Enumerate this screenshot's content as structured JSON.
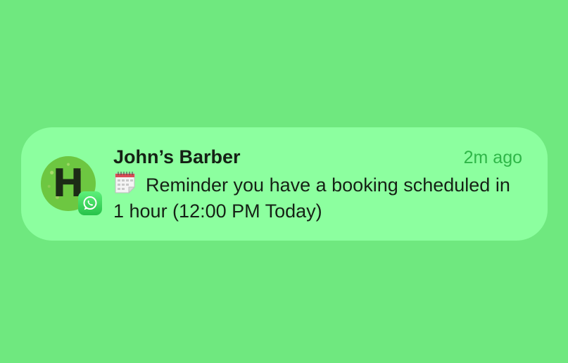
{
  "notification": {
    "avatar_letter": "H",
    "app_icon": "whatsapp-icon",
    "title": "John’s Barber",
    "time": "2m ago",
    "message_icon": "calendar-icon",
    "message": "Reminder you have a booking scheduled in 1 hour (12:00 PM Today)"
  },
  "colors": {
    "background": "#6fe87f",
    "card": "#8cff9f",
    "time_text": "#2fb648",
    "text": "#152115"
  }
}
